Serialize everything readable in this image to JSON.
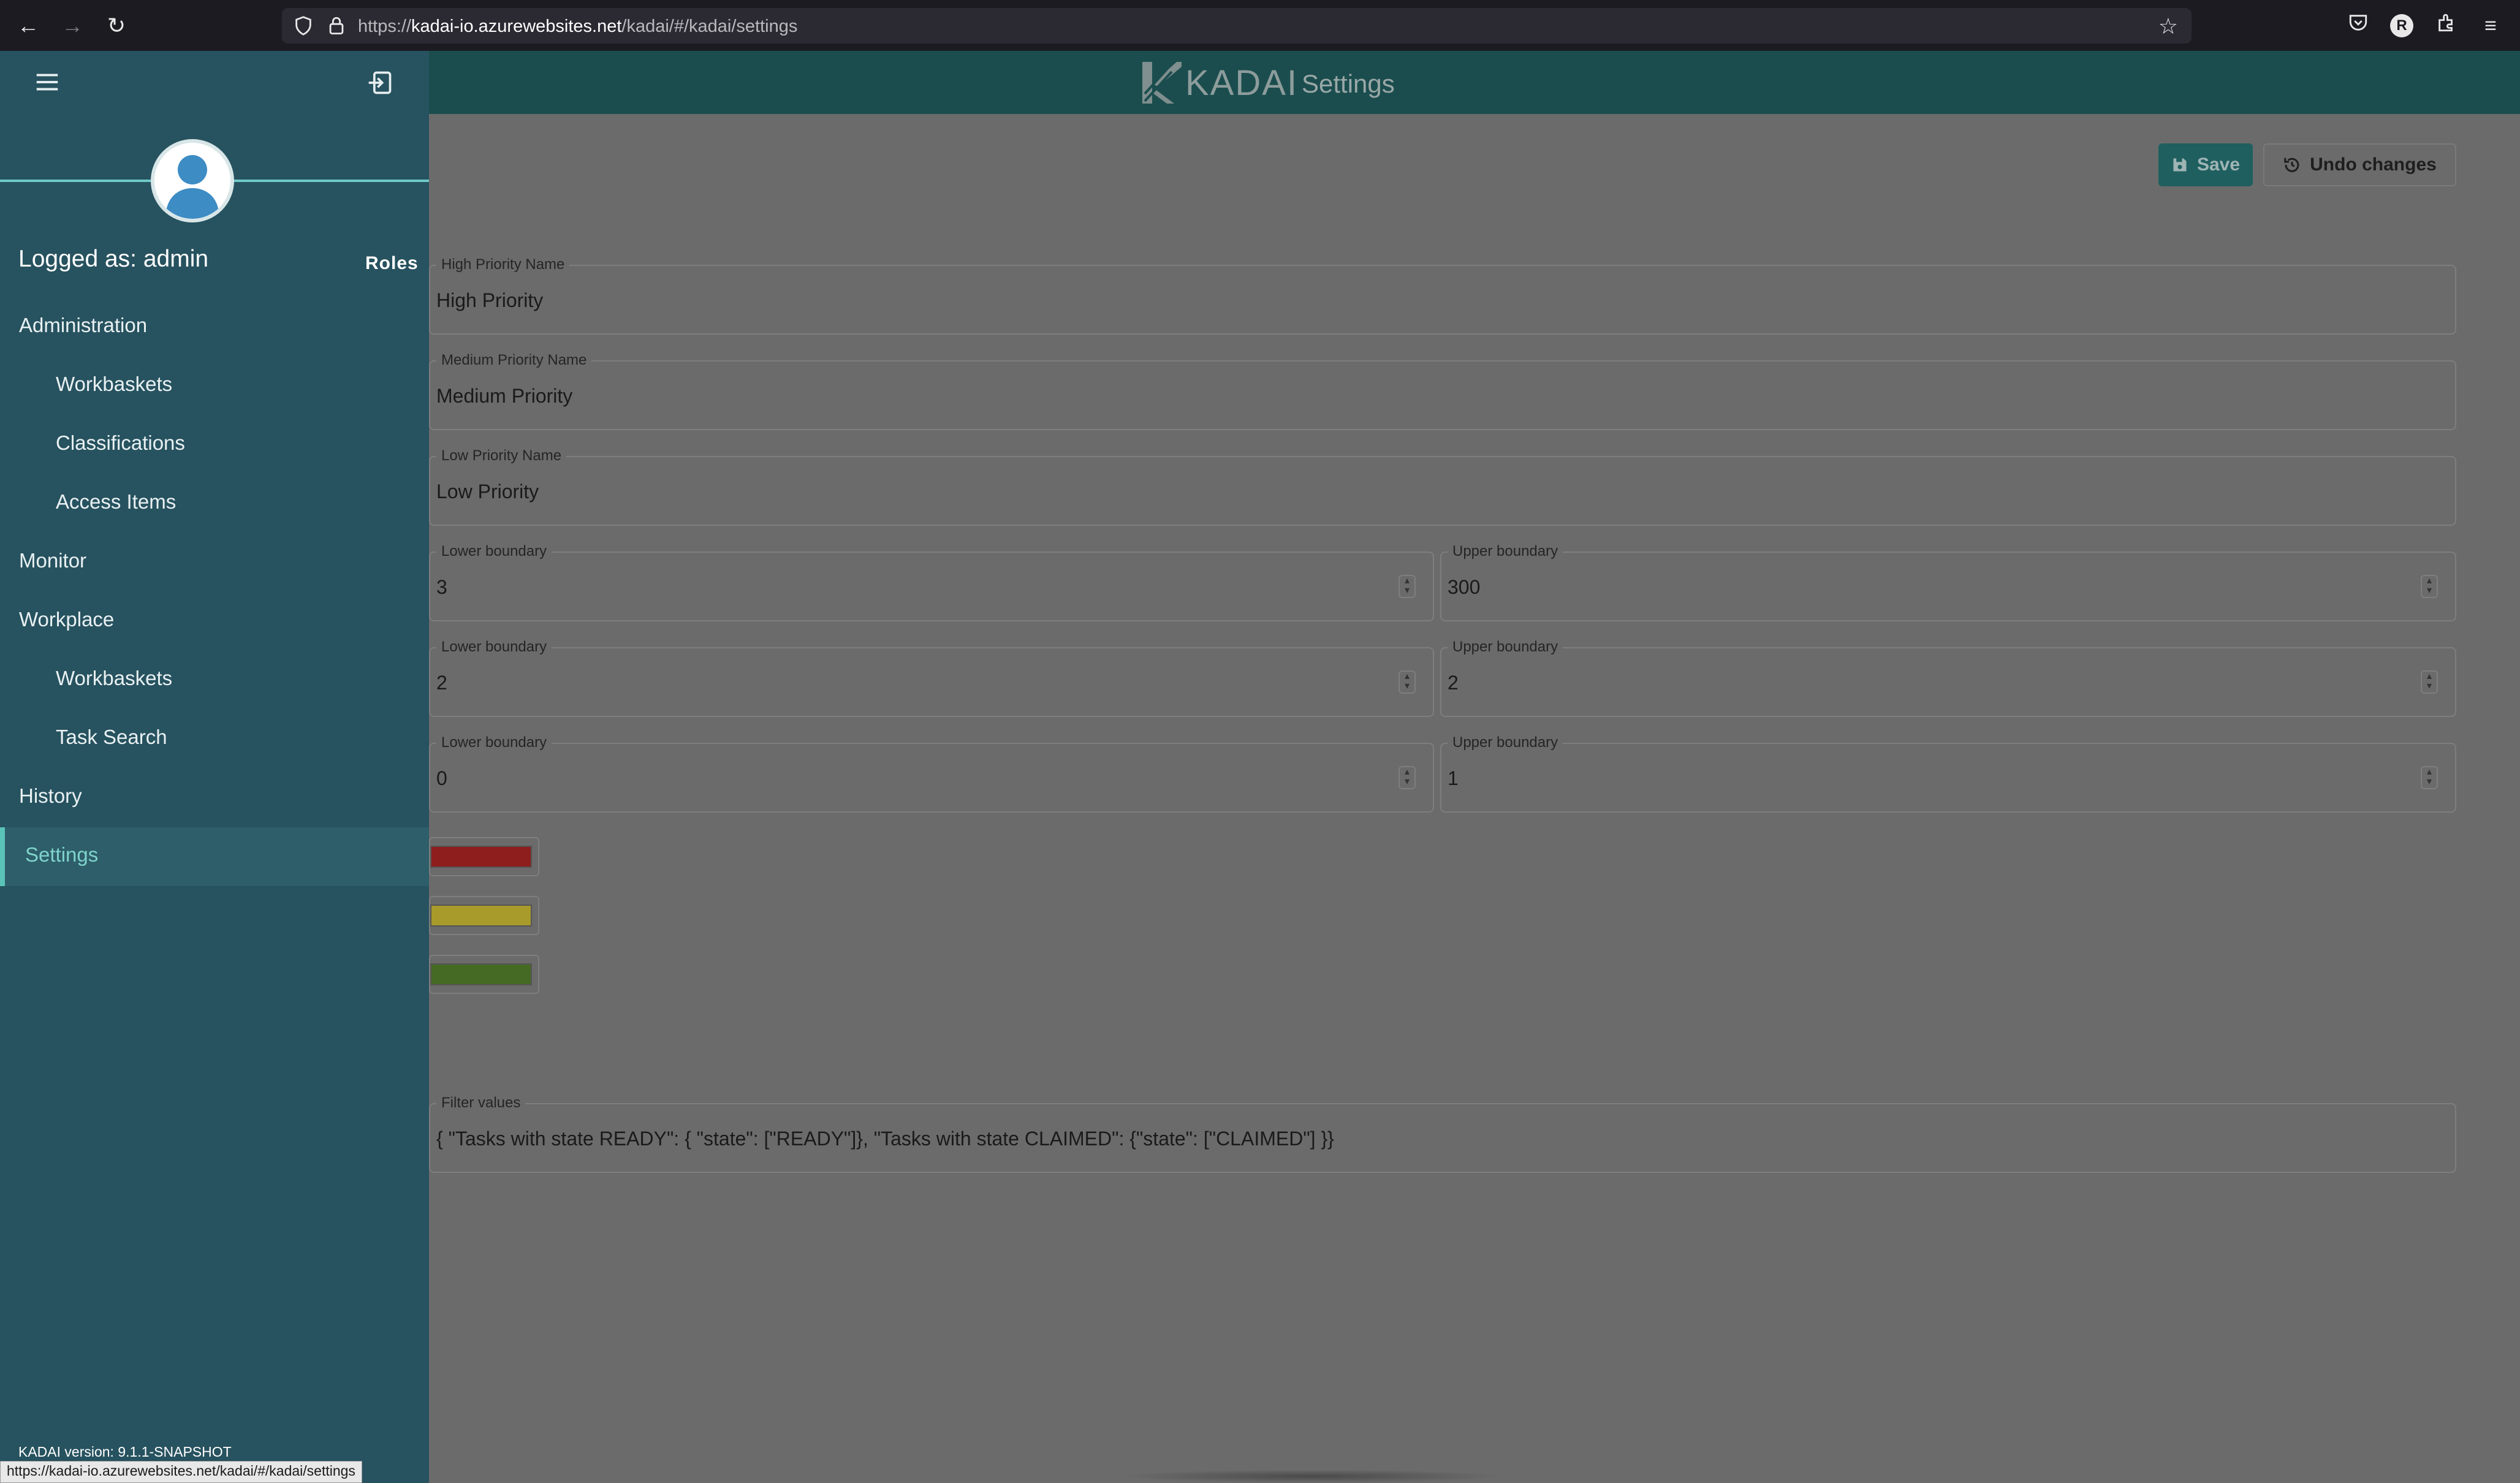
{
  "browser": {
    "url_prefix": "https://",
    "url_host": "kadai-io.azurewebsites.net",
    "url_path": "/kadai/#/kadai/settings",
    "profile_initial": "R"
  },
  "header": {
    "logo_text": "KADAI",
    "page_title": "Settings"
  },
  "toolbar": {
    "save_label": "Save",
    "undo_label": "Undo changes"
  },
  "sidebar": {
    "logged_as": "Logged as: admin",
    "roles_label": "Roles",
    "items": [
      {
        "label": "Administration",
        "level": 0
      },
      {
        "label": "Workbaskets",
        "level": 1
      },
      {
        "label": "Classifications",
        "level": 1
      },
      {
        "label": "Access Items",
        "level": 1
      },
      {
        "label": "Monitor",
        "level": 0
      },
      {
        "label": "Workplace",
        "level": 0
      },
      {
        "label": "Workbaskets",
        "level": 1
      },
      {
        "label": "Task Search",
        "level": 1
      },
      {
        "label": "History",
        "level": 0
      },
      {
        "label": "Settings",
        "level": 0,
        "active": true
      }
    ],
    "version": "KADAI version: 9.1.1-SNAPSHOT"
  },
  "settings": {
    "high_priority": {
      "label": "High Priority Name",
      "value": "High Priority"
    },
    "medium_priority": {
      "label": "Medium Priority Name",
      "value": "Medium Priority"
    },
    "low_priority": {
      "label": "Low Priority Name",
      "value": "Low Priority"
    },
    "boundaries": [
      {
        "lower_label": "Lower boundary",
        "lower": "3",
        "upper_label": "Upper boundary",
        "upper": "300"
      },
      {
        "lower_label": "Lower boundary",
        "lower": "2",
        "upper_label": "Upper boundary",
        "upper": "2"
      },
      {
        "lower_label": "Lower boundary",
        "lower": "0",
        "upper_label": "Upper boundary",
        "upper": "1"
      }
    ],
    "colors": {
      "high": "#8e1d1d",
      "medium": "#a89a2b",
      "low": "#456a23"
    },
    "filter": {
      "label": "Filter values",
      "value": "{ \"Tasks with state READY\": { \"state\": [\"READY\"]}, \"Tasks with state CLAIMED\": {\"state\": [\"CLAIMED\"] }}"
    }
  },
  "status_bar_url": "https://kadai-io.azurewebsites.net/kadai/#/kadai/settings",
  "theme": {
    "sidebar": "#27525f",
    "header": "#1b4d4e",
    "accent": "#5bc2b8",
    "overlay": "#6b6b6b"
  }
}
